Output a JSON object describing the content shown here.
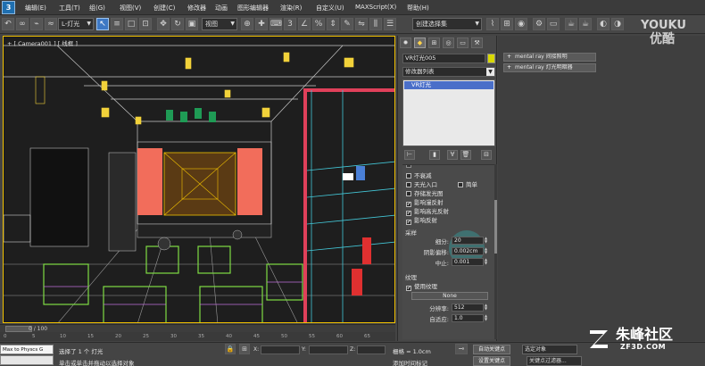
{
  "menubar": {
    "items": [
      "编辑(E)",
      "工具(T)",
      "组(G)",
      "视图(V)",
      "创建(C)",
      "修改器",
      "动画",
      "图形编辑器",
      "渲染(R)",
      "自定义(U)",
      "MAXScript(X)",
      "帮助(H)"
    ]
  },
  "toolbar": {
    "filter_label": "L-灯光",
    "view_label": "视图",
    "selection_set_label": "创建选择集"
  },
  "viewport": {
    "label": "+ [ Camera001 ] [ 线框 ]"
  },
  "timeline": {
    "frame_label": "0 / 100",
    "ticks": [
      "0",
      "5",
      "10",
      "15",
      "20",
      "25",
      "30",
      "35",
      "40",
      "45",
      "50",
      "55",
      "60",
      "65"
    ]
  },
  "command_panel": {
    "object_name": "VR灯光005",
    "modifier_list_label": "修改器列表",
    "stack_item": "VR灯光",
    "checkboxes": [
      {
        "label": "不衰减",
        "checked": false
      },
      {
        "label": "天光入口",
        "checked": false
      },
      {
        "label": "存储发光图",
        "checked": false
      },
      {
        "label": "影响漫反射",
        "checked": true
      },
      {
        "label": "影响高光反射",
        "checked": true
      },
      {
        "label": "影响反射",
        "checked": true
      }
    ],
    "simple_label": "简单",
    "sampling": {
      "title": "采样",
      "subdivs_label": "细分:",
      "subdivs_value": "20",
      "shadow_bias_label": "阴影偏移:",
      "shadow_bias_value": "0.002cm",
      "cutoff_label": "中止:",
      "cutoff_value": "0.001"
    },
    "texture": {
      "title": "纹理",
      "use_texture_label": "使用纹理",
      "use_texture_checked": true,
      "none_label": "None",
      "resolution_label": "分辨率:",
      "resolution_value": "512",
      "adaptive_label": "自适应:",
      "adaptive_value": "1.0"
    }
  },
  "right_panel": {
    "rollouts": [
      "mental ray 间接照明",
      "mental ray 灯光明暗器"
    ]
  },
  "statusbar": {
    "maxscript_label": "Max to Physcs G",
    "selected_text": "选择了 1 个 灯光",
    "prompt_text": "单击或单击并拖动以选择对象",
    "x_label": "X:",
    "y_label": "Y:",
    "z_label": "Z:",
    "grid_text": "栅格 = 1.0cm",
    "add_time_tag": "添加时间标记",
    "auto_key": "自动关键点",
    "set_key": "设置关键点",
    "selected_object": "选定对象",
    "key_filters": "关键点过滤器..."
  },
  "watermarks": {
    "youku_en": "YOUKU",
    "youku_cn": "优酷",
    "site_name": "朱峰社区",
    "site_url": "ZF3D.COM"
  },
  "colors": {
    "viewport_border": "#f2c200",
    "selection_blue": "#4a6fc9"
  }
}
